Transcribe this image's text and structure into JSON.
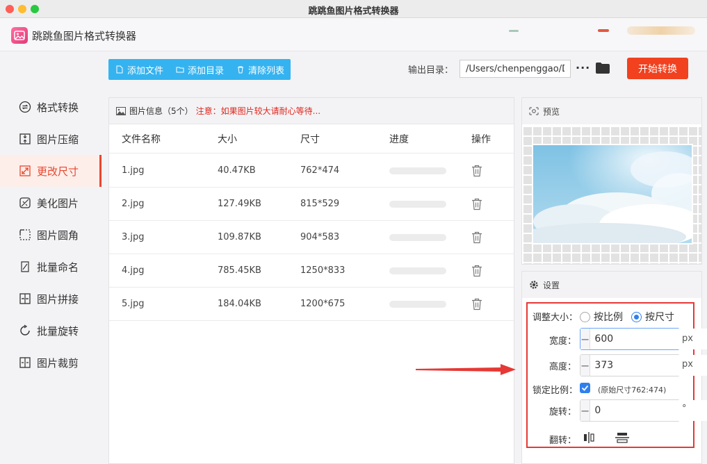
{
  "window": {
    "title": "跳跳鱼图片格式转换器"
  },
  "app": {
    "name": "跳跳鱼图片格式转换器"
  },
  "sidebar": {
    "items": [
      {
        "label": "格式转换",
        "icon": "convert-icon",
        "active": false
      },
      {
        "label": "图片压缩",
        "icon": "compress-icon",
        "active": false
      },
      {
        "label": "更改尺寸",
        "icon": "resize-icon",
        "active": true
      },
      {
        "label": "美化图片",
        "icon": "beautify-icon",
        "active": false
      },
      {
        "label": "图片圆角",
        "icon": "rounded-corner-icon",
        "active": false
      },
      {
        "label": "批量命名",
        "icon": "rename-icon",
        "active": false
      },
      {
        "label": "图片拼接",
        "icon": "stitch-icon",
        "active": false
      },
      {
        "label": "批量旋转",
        "icon": "rotate-icon",
        "active": false
      },
      {
        "label": "图片裁剪",
        "icon": "crop-icon",
        "active": false
      }
    ]
  },
  "toolbar": {
    "add_file": "添加文件",
    "add_dir": "添加目录",
    "clear_list": "清除列表",
    "output_label": "输出目录：",
    "output_path": "/Users/chenpenggao/Desktop",
    "more": "···",
    "start": "开始转换"
  },
  "file_panel": {
    "header": "图片信息（5个）",
    "warning": "注意：如果图片较大请耐心等待...",
    "columns": [
      "文件名称",
      "大小",
      "尺寸",
      "进度",
      "操作"
    ],
    "rows": [
      {
        "name": "1.jpg",
        "size": "40.47KB",
        "dim": "762*474",
        "progress": 0
      },
      {
        "name": "2.jpg",
        "size": "127.49KB",
        "dim": "815*529",
        "progress": 0
      },
      {
        "name": "3.jpg",
        "size": "109.87KB",
        "dim": "904*583",
        "progress": 0
      },
      {
        "name": "4.jpg",
        "size": "785.45KB",
        "dim": "1250*833",
        "progress": 0
      },
      {
        "name": "5.jpg",
        "size": "184.04KB",
        "dim": "1200*675",
        "progress": 0
      }
    ]
  },
  "preview": {
    "title": "预览"
  },
  "settings": {
    "title": "设置",
    "resize_label": "调整大小：",
    "by_ratio": "按比例",
    "by_size": "按尺寸",
    "selected_mode": "by_size",
    "width_label": "宽度：",
    "width_value": "600",
    "height_label": "高度：",
    "height_value": "373",
    "unit_px": "px",
    "lock_label": "锁定比例：",
    "lock_checked": true,
    "original_size": "(原始尺寸762:474)",
    "rotate_label": "旋转：",
    "rotate_value": "0",
    "degree": "°",
    "flip_label": "翻转：",
    "minus": "−",
    "plus": "+"
  },
  "colors": {
    "accent_red": "#f1411f",
    "toolbar_blue": "#35b3f0",
    "radio_blue": "#2f80ed",
    "warning_red": "#e0251b"
  }
}
